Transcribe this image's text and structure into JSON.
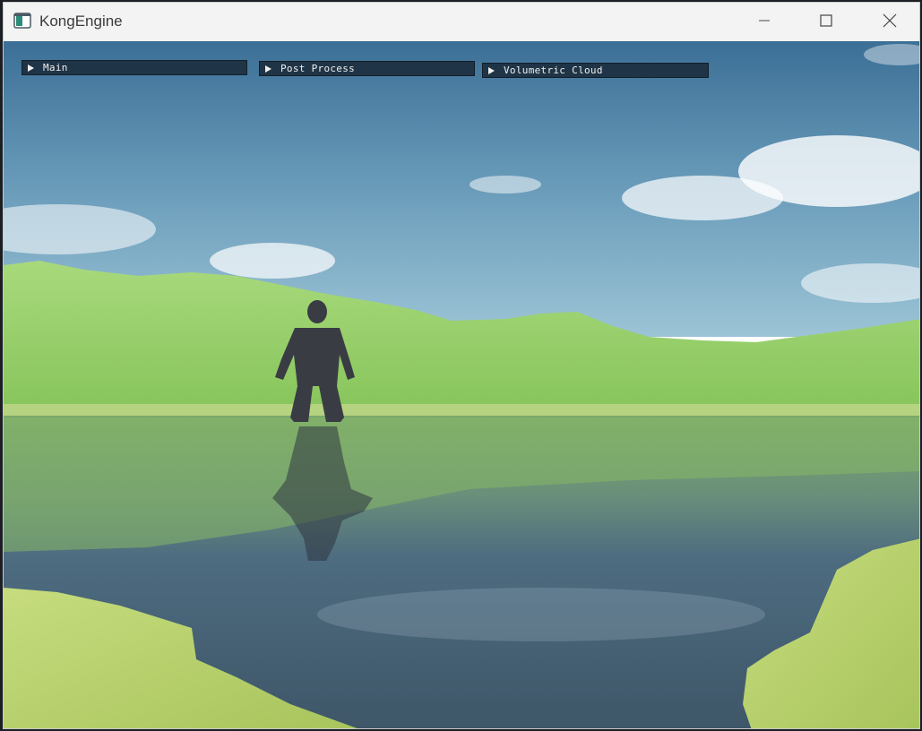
{
  "window": {
    "title": "KongEngine",
    "icons": {
      "app": "app-window-icon",
      "minimize": "minimize-icon",
      "maximize": "maximize-icon",
      "close": "close-icon"
    }
  },
  "panels": [
    {
      "label": "Main",
      "state": "collapsed",
      "icon": "collapse-arrow-right-icon"
    },
    {
      "label": "Post Process",
      "state": "collapsed",
      "icon": "collapse-arrow-right-icon"
    },
    {
      "label": "Volumetric Cloud",
      "state": "collapsed",
      "icon": "collapse-arrow-right-icon"
    }
  ],
  "colors": {
    "panel_header": "#1f3446",
    "sky_top": "#3c6f96",
    "sky_horizon": "#9cc4d6",
    "grass": "#8cc85a",
    "water": "#4a6478"
  }
}
